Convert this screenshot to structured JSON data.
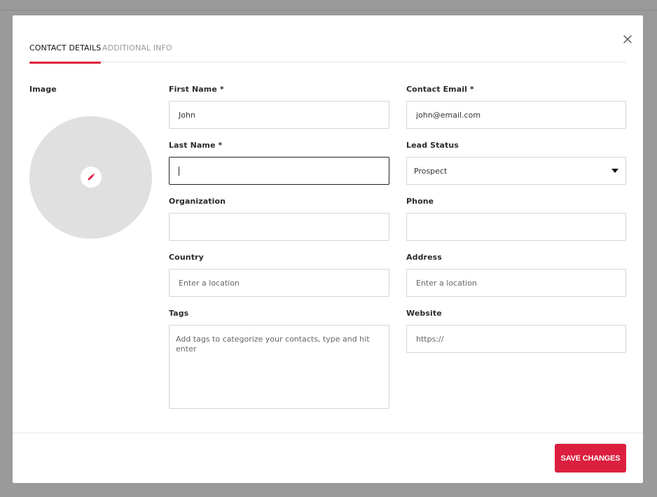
{
  "tabs": [
    {
      "label": "CONTACT DETAILS",
      "active": true
    },
    {
      "label": "ADDITIONAL INFO",
      "active": false
    }
  ],
  "image": {
    "label": "Image"
  },
  "fields": {
    "first_name": {
      "label": "First Name *",
      "value": "John"
    },
    "contact_email": {
      "label": "Contact Email *",
      "value": "john@email.com"
    },
    "last_name": {
      "label": "Last Name *",
      "value": ""
    },
    "lead_status": {
      "label": "Lead Status",
      "value": "Prospect"
    },
    "organization": {
      "label": "Organization",
      "value": ""
    },
    "phone": {
      "label": "Phone",
      "value": ""
    },
    "country": {
      "label": "Country",
      "placeholder": "Enter a location"
    },
    "address": {
      "label": "Address",
      "placeholder": "Enter a location"
    },
    "tags": {
      "label": "Tags",
      "placeholder": "Add tags to categorize your contacts, type and hit enter"
    },
    "website": {
      "label": "Website",
      "placeholder": "https://"
    }
  },
  "footer": {
    "save_label": "SAVE CHANGES"
  },
  "colors": {
    "accent": "#dc1f3f",
    "backdrop": "#9a9a9a",
    "avatar_bg": "#e0e0e0"
  },
  "icons": {
    "close": "close-icon",
    "edit": "pencil-icon",
    "dropdown": "chevron-down-icon"
  }
}
